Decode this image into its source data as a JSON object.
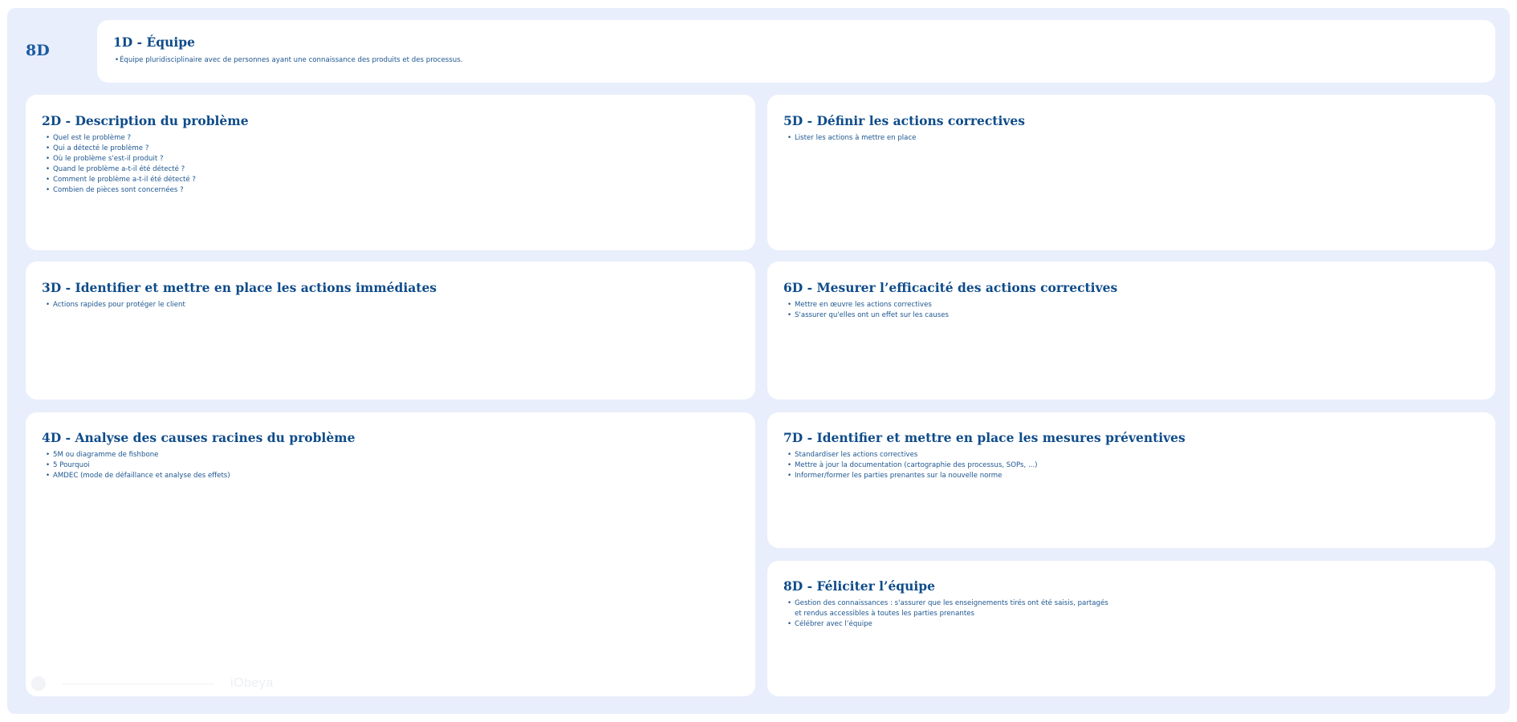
{
  "board": {
    "title": "8D",
    "background": "#e8eefb",
    "heading_color": "#0f4c8a",
    "text_color": "#1d568f"
  },
  "sections": {
    "d1": {
      "title": "1D - Équipe",
      "items": [
        "Équipe pluridisciplinaire avec de personnes ayant une connaissance des produits et des processus."
      ]
    },
    "d2": {
      "title": "2D - Description du problème",
      "items": [
        "Quel est le problème ?",
        "Qui a détecté le problème ?",
        "Où le problème s'est-il produit ?",
        "Quand le problème a-t-il été détecté ?",
        "Comment le problème a-t-il été détecté ?",
        "Combien de pièces sont concernées ?"
      ]
    },
    "d3": {
      "title": "3D - Identifier et mettre en place les actions immédiates",
      "items": [
        "Actions rapides pour protéger le client"
      ]
    },
    "d4": {
      "title": "4D - Analyse des causes racines du problème",
      "items": [
        "5M ou diagramme de fishbone",
        "5 Pourquoi",
        "AMDEC (mode de défaillance et analyse des effets)"
      ]
    },
    "d5": {
      "title": "5D - Définir les actions correctives",
      "items": [
        "Lister les actions à mettre en place"
      ]
    },
    "d6": {
      "title": "6D - Mesurer l’efficacité des actions correctives",
      "items": [
        "Mettre en œuvre les actions correctives",
        "S'assurer qu'elles ont un effet sur les causes"
      ]
    },
    "d7": {
      "title": "7D - Identifier et mettre en place les mesures préventives",
      "items": [
        "Standardiser les actions correctives",
        "Mettre à jour la documentation (cartographie des processus, SOPs, ...)",
        "Informer/former les parties prenantes sur la nouvelle norme"
      ]
    },
    "d8": {
      "title": "8D - Féliciter l’équipe",
      "items": [
        "Gestion des connaissances : s'assurer que les enseignements tirés ont été saisis, partagés",
        "et rendus accessibles à toutes les parties prenantes",
        "Célébrer avec l’équipe"
      ]
    }
  },
  "watermark": {
    "text": "iObeya"
  }
}
